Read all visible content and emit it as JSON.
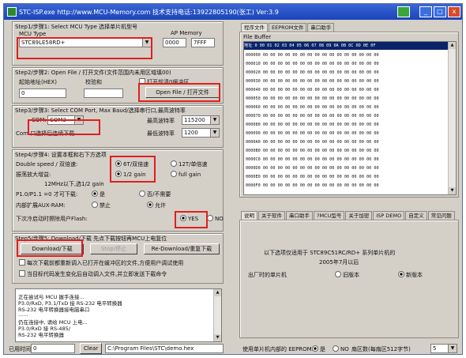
{
  "window": {
    "title": "STC-ISP.exe http://www.MCU-Memory.com 技术支持电话:13922805190(张工) Ver:3.9",
    "min": "_",
    "max": "□",
    "close": "x"
  },
  "step1": {
    "header": "Step1/步骤1: Select MCU Type 选择单片机型号",
    "mcu_label": "MCU Type",
    "mcu_value": "STC89LE58RD+",
    "ap_label": "AP Memory",
    "ap_start": "0000",
    "ap_end": "7FFF"
  },
  "step2": {
    "header": "Step2/步骤2: Open File / 打开文件(文件范围内未用区域填00)",
    "offset_label": "起始地址(HEX)",
    "checksum_label": "校验和",
    "clear_label": "打开前清0缓冲区",
    "offset_value": "0",
    "checksum_value": "",
    "open_button": "Open File / 打开文件"
  },
  "step3": {
    "header": "Step3/步骤3: Select COM Port, Max Baud/选择串行口,最高波特率",
    "com_label": "COM:",
    "com_value": "COM3",
    "maxbaud_label": "最高波特率",
    "maxbaud_value": "115200",
    "minbaud_label": "最低波特率",
    "minbaud_value": "1200",
    "note": "Com 口选择后连续下载"
  },
  "step4": {
    "header": "Step4/步骤4: 设置本框和右下方选项",
    "double_label": "Double speed / 双倍速:",
    "opt_6t": "6T/双倍速",
    "opt_12t": "12T/单倍速",
    "amp_label": "振荡放大增益:",
    "opt_half": "1/2 gain",
    "opt_full": "full gain",
    "osc_note": "12MHz以下,选1/2 gain",
    "ale_label": "P1.0/P1.1 =0 才可下载:",
    "ale_yes": "是",
    "ale_no": "否/不需要",
    "xram_label": "内部扩展AUX-RAM:",
    "xram_no": "禁止",
    "xram_yes": "允许",
    "flash_label": "下次冷启动时擦除用户Flash:",
    "flash_yes": "YES",
    "flash_no": "NO"
  },
  "step5": {
    "header": "Step5/步骤5: Download/下载 先点下载按钮再MCU上电复位",
    "download_button": "Download/下载",
    "stop_button": "Stop/停止",
    "redownload_button": "Re-Download/重复下载",
    "check1": "每次下载前都重新调入已打开在缓冲区的文件,方便用户调试使用",
    "check2": "当目标代码发生变化后自动调入文件,并立即发送下载命令"
  },
  "log": {
    "lines": [
      "正在尝试与 MCU 握手连接...",
      "P3.0/RxD, P3.1/TxD 接 RS-232 电平转换器",
      "RS-232 电平转换器接电脑串口",
      "......",
      "仍在连接中, 请给 MCU 上电...",
      "P3.0/RxD 接 RS-485/",
      "RS-232 电平转换器"
    ]
  },
  "status": {
    "label": "已用时间",
    "value": "0",
    "clear_button": "Clear",
    "path": "C:\\Program Files\\STC\\demo.hex"
  },
  "buffer": {
    "tabs": [
      "程序文件",
      "EEPROM文件",
      "串口助手"
    ],
    "label": "File Buffer",
    "header": "地址 0   00 01 02 03 04 05 06 07 08 09 0A 0B 0C 0D 0E 0F",
    "rows": [
      "000000  00 00 00 00 00 00 00 00 00 00 00 00 00 00 00 00",
      "000010  00 00 00 00 00 00 00 00 00 00 00 00 00 00 00 00",
      "000020  00 00 00 00 00 00 00 00 00 00 00 00 00 00 00 00",
      "000030  00 00 00 00 00 00 00 00 00 00 00 00 00 00 00 00",
      "000040  00 00 00 00 00 00 00 00 00 00 00 00 00 00 00 00",
      "000050  00 00 00 00 00 00 00 00 00 00 00 00 00 00 00 00",
      "000060  00 00 00 00 00 00 00 00 00 00 00 00 00 00 00 00",
      "000070  00 00 00 00 00 00 00 00 00 00 00 00 00 00 00 00",
      "000080  00 00 00 00 00 00 00 00 00 00 00 00 00 00 00 00",
      "000090  00 00 00 00 00 00 00 00 00 00 00 00 00 00 00 00",
      "0000A0  00 00 00 00 00 00 00 00 00 00 00 00 00 00 00 00",
      "0000B0  00 00 00 00 00 00 00 00 00 00 00 00 00 00 00 00",
      "0000C0  00 00 00 00 00 00 00 00 00 00 00 00 00 00 00 00",
      "0000D0  00 00 00 00 00 00 00 00 00 00 00 00 00 00 00 00",
      "0000E0  00 00 00 00 00 00 00 00 00 00 00 00 00 00 00 00",
      "0000F0  00 00 00 00 00 00 00 00 00 00 00 00 00 00 00 00"
    ]
  },
  "lower_tabs": [
    "说明",
    "关于软件",
    "串口助手",
    "?MCU型号",
    "关于加密",
    "ISP DEMO",
    "自定义",
    "常见问题"
  ],
  "info": {
    "line1": "以下选项仅适用于 STC89C51RC/RD+ 系列单片机的",
    "line2": "2005年7月以后",
    "line3": "出厂时的单片机",
    "opt_a": "旧版本",
    "opt_b": "新版本"
  },
  "bottom_right": {
    "label": "使用单片机内部的 EEPROM:",
    "opt_yes": "是",
    "opt_no": "NO",
    "sectors_label": "扇区数(每扇区512字节)",
    "sectors_value": "5"
  }
}
